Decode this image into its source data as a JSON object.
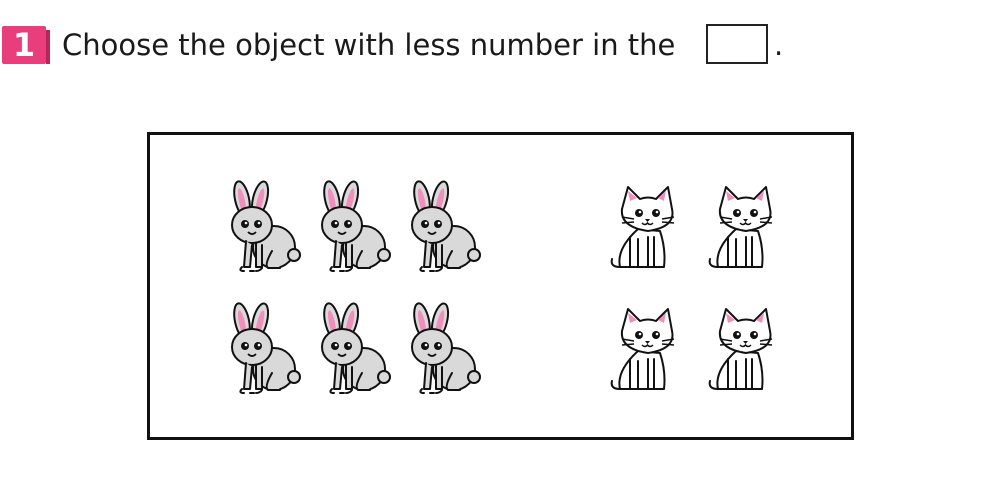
{
  "question": {
    "number": "1",
    "text": "Choose the object with less number in the",
    "period": "."
  },
  "groups": [
    {
      "animal": "rabbit",
      "count": 6,
      "icon": "rabbit-icon",
      "colors": {
        "body": "#d9d9d9",
        "ear_inner": "#f08fbd",
        "outline": "#111111"
      }
    },
    {
      "animal": "cat",
      "count": 4,
      "icon": "cat-icon",
      "colors": {
        "body": "#ffffff",
        "ear_inner": "#f08fbd",
        "outline": "#111111"
      }
    }
  ],
  "colors": {
    "badge": "#e83e7c",
    "text": "#1a1a1a",
    "frame": "#111111"
  }
}
